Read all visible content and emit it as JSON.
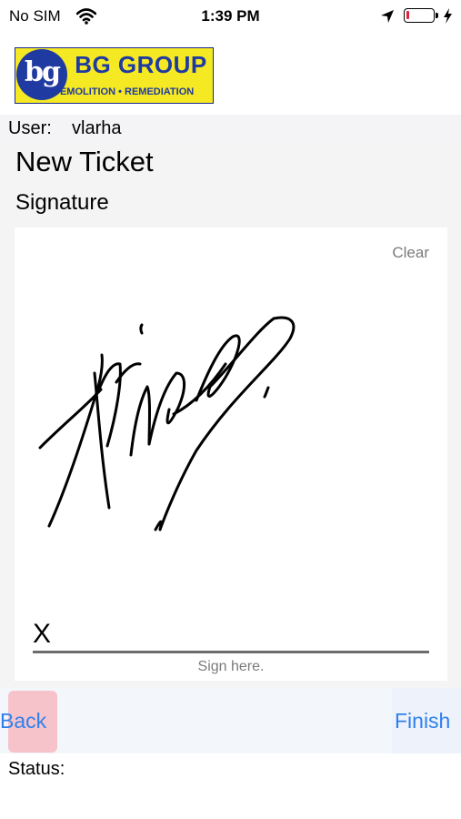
{
  "status_bar": {
    "carrier": "No SIM",
    "time": "1:39 PM",
    "battery_level": 0.12,
    "battery_color": "#e2233b"
  },
  "logo": {
    "monogram": "bg",
    "title": "BG GROUP",
    "subtitle": "DEMOLITION • REMEDIATION",
    "bg_color": "#f5e924",
    "brand_color": "#1f3aa0"
  },
  "user": {
    "label": "User:",
    "value": "vlarha"
  },
  "page": {
    "title": "New Ticket",
    "subtitle": "Signature"
  },
  "signature_pad": {
    "clear_label": "Clear",
    "mark": "X",
    "hint": "Sign here."
  },
  "nav": {
    "back_label": "Back",
    "finish_label": "Finish",
    "accent_color": "#2f80ed",
    "back_bg": "#f7c3cb"
  },
  "status": {
    "label": "Status:",
    "value": ""
  },
  "icons": [
    "wifi-icon",
    "location-arrow-icon",
    "battery-icon",
    "charging-bolt-icon"
  ]
}
